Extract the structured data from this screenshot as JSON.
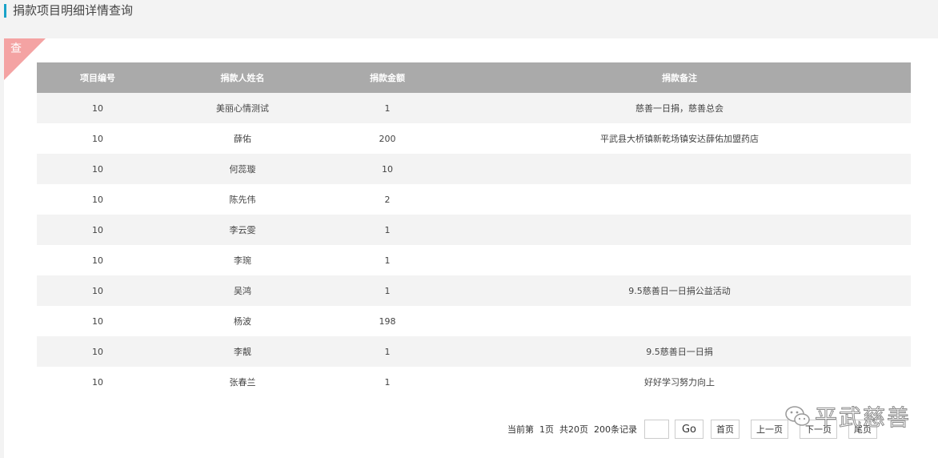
{
  "header": {
    "title": "捐款项目明细详情查询"
  },
  "badge": {
    "label": "查"
  },
  "table": {
    "columns": [
      "项目编号",
      "捐款人姓名",
      "捐款金额",
      "捐款备注"
    ],
    "rows": [
      [
        "10",
        "美丽心情测试",
        "1",
        "慈善一日捐，慈善总会"
      ],
      [
        "10",
        "薛佑",
        "200",
        "平武县大桥镇新乾场镇安达薛佑加盟药店"
      ],
      [
        "10",
        "何蕊璇",
        "10",
        ""
      ],
      [
        "10",
        "陈先伟",
        "2",
        ""
      ],
      [
        "10",
        "李云雯",
        "1",
        ""
      ],
      [
        "10",
        "李琬",
        "1",
        ""
      ],
      [
        "10",
        "吴鸿",
        "1",
        "9.5慈善日一日捐公益活动"
      ],
      [
        "10",
        "杨波",
        "198",
        ""
      ],
      [
        "10",
        "李靓",
        "1",
        "9.5慈善日一日捐"
      ],
      [
        "10",
        "张春兰",
        "1",
        "好好学习努力向上"
      ]
    ]
  },
  "pager": {
    "current_label": "当前第",
    "current_page": "1页",
    "total_pages": "共20页",
    "total_records": "200条记录",
    "input_value": "",
    "go": "Go",
    "first": "首页",
    "prev": "上一页",
    "next": "下一页",
    "last": "尾页"
  },
  "watermark": {
    "text": "平武慈善",
    "icon": "wechat-icon"
  }
}
